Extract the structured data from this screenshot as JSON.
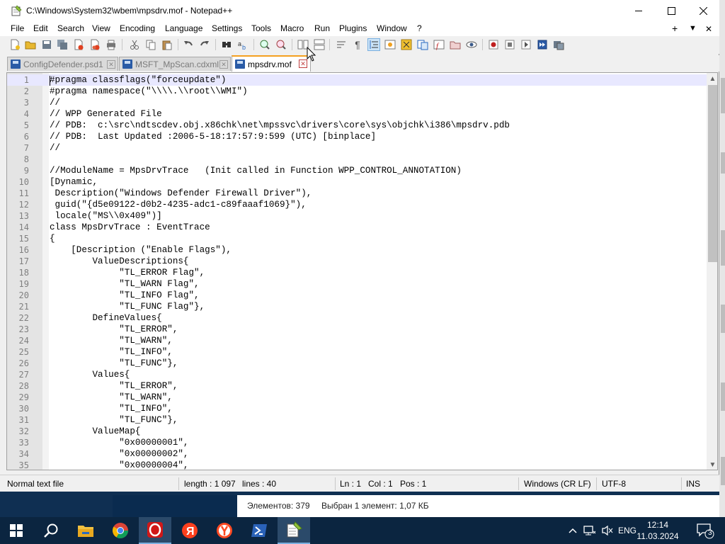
{
  "window": {
    "title": "C:\\Windows\\System32\\wbem\\mpsdrv.mof - Notepad++",
    "minimize_icon": "minimize-icon",
    "maximize_icon": "maximize-icon",
    "close_icon": "close-icon"
  },
  "menu": {
    "items": [
      "File",
      "Edit",
      "Search",
      "View",
      "Encoding",
      "Language",
      "Settings",
      "Tools",
      "Macro",
      "Run",
      "Plugins",
      "Window",
      "?"
    ],
    "right": {
      "plus": "+",
      "down": "▼",
      "close": "✕"
    }
  },
  "toolbar": {
    "icons": [
      "new-file-icon",
      "open-file-icon",
      "save-icon",
      "save-all-icon",
      "close-icon",
      "close-all-icon",
      "print-icon",
      "cut-icon",
      "copy-icon",
      "paste-icon",
      "undo-icon",
      "redo-icon",
      "find-icon",
      "replace-icon",
      "zoom-in-icon",
      "zoom-out-icon",
      "sync-vertical-icon",
      "sync-horizontal-icon",
      "word-wrap-icon",
      "show-all-chars-icon",
      "indent-guide-icon",
      "udl-icon",
      "document-map-icon",
      "function-list-icon",
      "folder-workspace-icon",
      "monitoring-icon",
      "record-macro-icon",
      "stop-record-icon",
      "play-macro-icon",
      "play-multiple-icon",
      "save-macro-icon"
    ]
  },
  "tabs": [
    {
      "label": "ConfigDefender.psd1",
      "active": false
    },
    {
      "label": "MSFT_MpScan.cdxml",
      "active": false
    },
    {
      "label": "mpsdrv.mof",
      "active": true
    }
  ],
  "editor": {
    "lines": [
      {
        "n": "1",
        "text": "#pragma classflags(\"forceupdate\")"
      },
      {
        "n": "2",
        "text": "#pragma namespace(\"\\\\\\\\.\\\\root\\\\WMI\")"
      },
      {
        "n": "3",
        "text": "//"
      },
      {
        "n": "4",
        "text": "// WPP Generated File"
      },
      {
        "n": "5",
        "text": "// PDB:  c:\\src\\ndtscdev.obj.x86chk\\net\\mpssvc\\drivers\\core\\sys\\objchk\\i386\\mpsdrv.pdb"
      },
      {
        "n": "6",
        "text": "// PDB:  Last Updated :2006-5-18:17:57:9:599 (UTC) [binplace]"
      },
      {
        "n": "7",
        "text": "//"
      },
      {
        "n": "8",
        "text": ""
      },
      {
        "n": "9",
        "text": "//ModuleName = MpsDrvTrace   (Init called in Function WPP_CONTROL_ANNOTATION)"
      },
      {
        "n": "10",
        "text": "[Dynamic,"
      },
      {
        "n": "11",
        "text": " Description(\"Windows Defender Firewall Driver\"),"
      },
      {
        "n": "12",
        "text": " guid(\"{d5e09122-d0b2-4235-adc1-c89faaaf1069}\"),"
      },
      {
        "n": "13",
        "text": " locale(\"MS\\\\0x409\")]"
      },
      {
        "n": "14",
        "text": "class MpsDrvTrace : EventTrace"
      },
      {
        "n": "15",
        "text": "{"
      },
      {
        "n": "16",
        "text": "    [Description (\"Enable Flags\"),"
      },
      {
        "n": "17",
        "text": "        ValueDescriptions{"
      },
      {
        "n": "18",
        "text": "             \"TL_ERROR Flag\","
      },
      {
        "n": "19",
        "text": "             \"TL_WARN Flag\","
      },
      {
        "n": "20",
        "text": "             \"TL_INFO Flag\","
      },
      {
        "n": "21",
        "text": "             \"TL_FUNC Flag\"},"
      },
      {
        "n": "22",
        "text": "        DefineValues{"
      },
      {
        "n": "23",
        "text": "             \"TL_ERROR\","
      },
      {
        "n": "24",
        "text": "             \"TL_WARN\","
      },
      {
        "n": "25",
        "text": "             \"TL_INFO\","
      },
      {
        "n": "26",
        "text": "             \"TL_FUNC\"},"
      },
      {
        "n": "27",
        "text": "        Values{"
      },
      {
        "n": "28",
        "text": "             \"TL_ERROR\","
      },
      {
        "n": "29",
        "text": "             \"TL_WARN\","
      },
      {
        "n": "30",
        "text": "             \"TL_INFO\","
      },
      {
        "n": "31",
        "text": "             \"TL_FUNC\"},"
      },
      {
        "n": "32",
        "text": "        ValueMap{"
      },
      {
        "n": "33",
        "text": "             \"0x00000001\","
      },
      {
        "n": "34",
        "text": "             \"0x00000002\","
      },
      {
        "n": "35",
        "text": "             \"0x00000004\","
      }
    ]
  },
  "status": {
    "filetype": "Normal text file",
    "length": "length : 1 097",
    "lines": "lines : 40",
    "ln": "Ln : 1",
    "col": "Col : 1",
    "pos": "Pos : 1",
    "eol": "Windows (CR LF)",
    "encoding": "UTF-8",
    "mode": "INS"
  },
  "background_explorer": {
    "items": "Элементов: 379",
    "selected": "Выбран 1 элемент: 1,07 КБ"
  },
  "taskbar": {
    "apps": [
      "windows-start-icon",
      "search-icon",
      "file-explorer-icon",
      "chrome-icon",
      "opera-icon",
      "yandex-icon",
      "yandex-browser-icon",
      "powershell-icon",
      "notepadpp-icon"
    ],
    "lang": "ENG",
    "time": "12:14",
    "date": "11.03.2024",
    "notifications": "3"
  },
  "colors": {
    "current_line": "#e8e8ff",
    "tab_accent": "#f4a020",
    "taskbar": "#0b2540"
  }
}
